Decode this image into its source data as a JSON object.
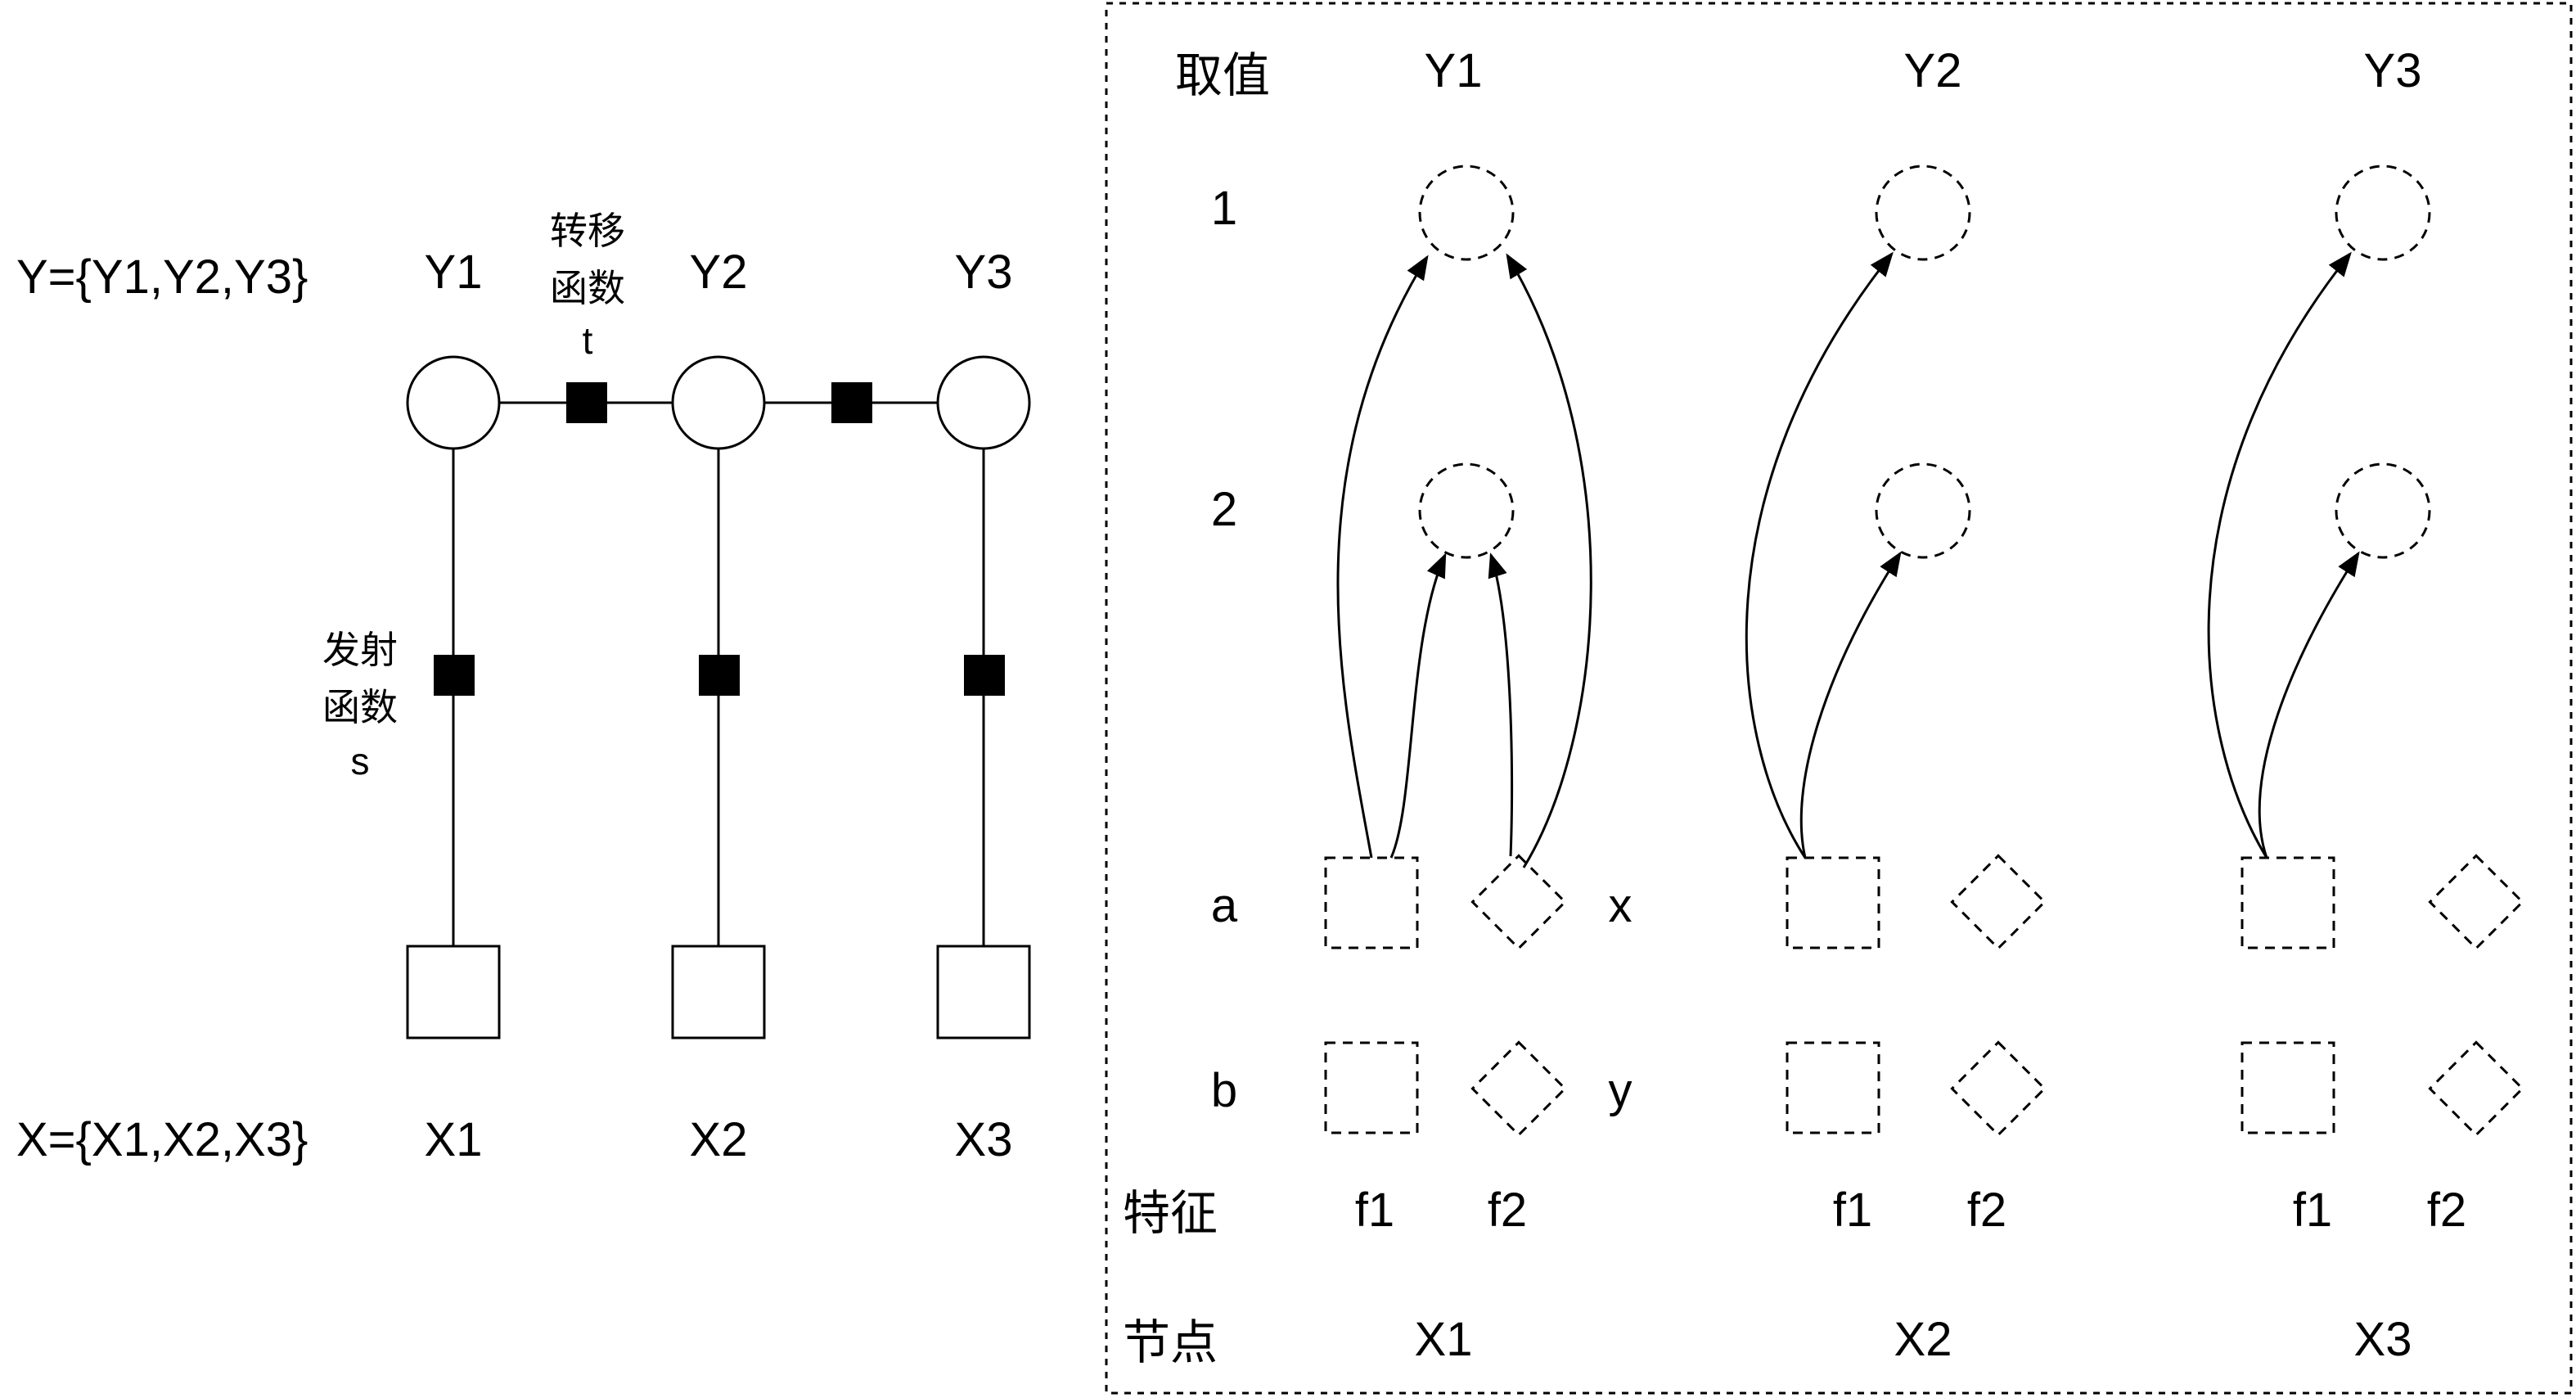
{
  "left": {
    "y_set_label": "Y={Y1,Y2,Y3}",
    "x_set_label": "X={X1,X2,X3}",
    "y_nodes": [
      "Y1",
      "Y2",
      "Y3"
    ],
    "x_nodes": [
      "X1",
      "X2",
      "X3"
    ],
    "transition_label": [
      "转移",
      "函数",
      "t"
    ],
    "emission_label": [
      "发射",
      "函数",
      "s"
    ]
  },
  "right": {
    "value_header": "取值",
    "y_columns": [
      "Y1",
      "Y2",
      "Y3"
    ],
    "y_values": [
      "1",
      "2"
    ],
    "x_values": [
      "a",
      "b"
    ],
    "f2_values": [
      "x",
      "y"
    ],
    "feature_header": "特征",
    "features": [
      "f1",
      "f2"
    ],
    "node_header": "节点",
    "x_columns": [
      "X1",
      "X2",
      "X3"
    ]
  },
  "colors": {
    "stroke": "#000000",
    "background": "#ffffff"
  }
}
